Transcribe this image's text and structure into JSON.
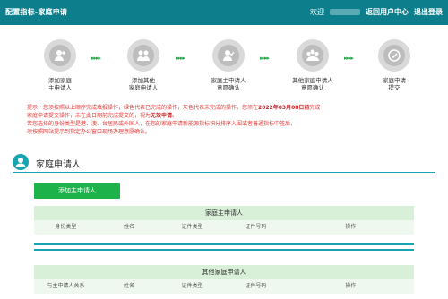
{
  "header": {
    "title": "配置指标-家庭申请",
    "welcome": "欢迎",
    "return_link": "返回用户中心",
    "logout_link": "退出登录"
  },
  "steps": [
    {
      "label1": "添加家庭",
      "label2": "主申请人",
      "icon": "person-add-icon"
    },
    {
      "label1": "添加其他",
      "label2": "家庭申请人",
      "icon": "family-icon"
    },
    {
      "label1": "家庭主申请人",
      "label2": "意愿确认",
      "icon": "person-check-icon"
    },
    {
      "label1": "其他家庭申请人",
      "label2": "意愿确认",
      "icon": "group-check-icon"
    },
    {
      "label1": "家庭申请",
      "label2": "提交",
      "icon": "submit-check-icon"
    }
  ],
  "notice": {
    "line1a": "提示：您须按照以上顺序完成填报操作，绿色代表已完成的操作，灰色代表未完成的操作。您须在",
    "line1b": "2022年03月08日前",
    "line1c": "完成",
    "line2a": "家庭申请提交操作，未在此日期前完成提交的，视为",
    "line2b": "无效申请",
    "line2c": "。",
    "line3": "若您选择的身份类型是港、澳、台居民或外国人，在您的家庭申请新能源指标积分排序入围或者普通指标中签后，",
    "line4": "须按照网站提示到指定办公窗口现场办理意愿确认。"
  },
  "section": {
    "title": "家庭申请人",
    "add_button": "添加主申请人"
  },
  "main_table": {
    "caption": "家庭主申请人",
    "columns": [
      "身份类型",
      "姓名",
      "证件类型",
      "证件号码",
      "操作"
    ]
  },
  "other_table": {
    "caption": "其他家庭申请人",
    "columns": [
      "与主申请人关系",
      "姓名",
      "证件类型",
      "证件号码",
      "操作"
    ]
  },
  "colors": {
    "header": "#0d7f8c",
    "accent": "#1aa3b0",
    "button": "#1db34a",
    "warning": "#e53935"
  }
}
